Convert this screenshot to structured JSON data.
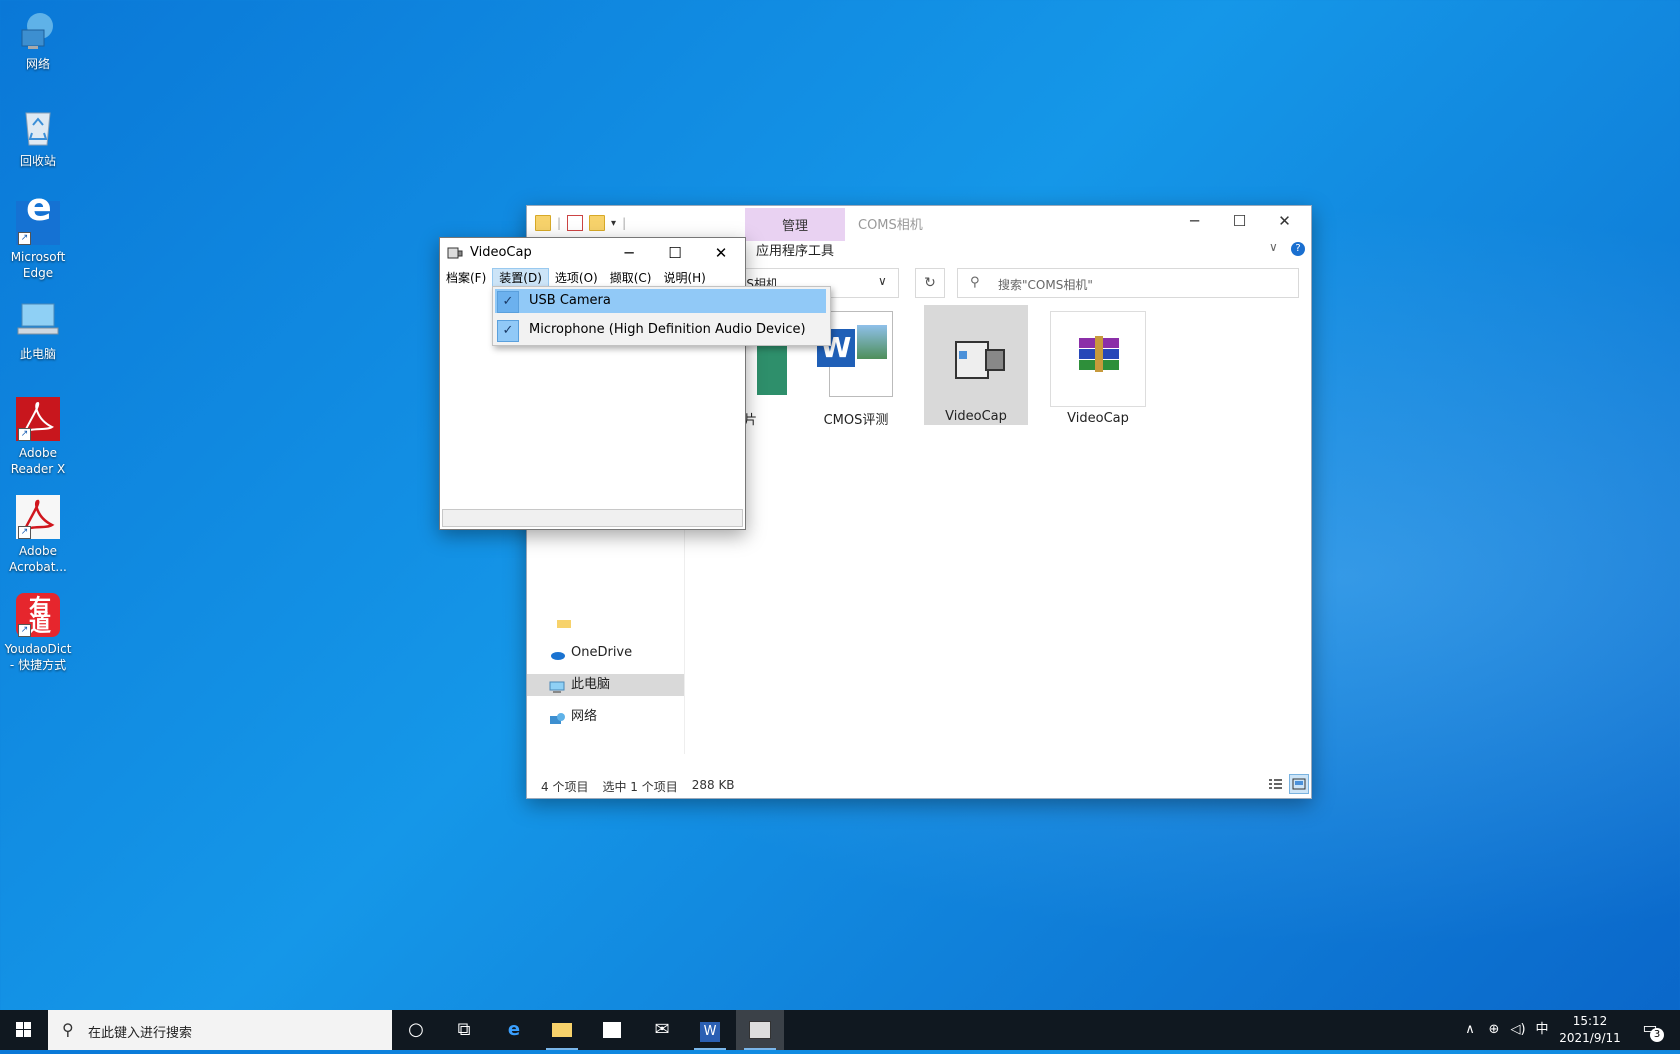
{
  "desktop": {
    "icons": [
      {
        "label": "网络",
        "icon": "network-icon"
      },
      {
        "label": "回收站",
        "icon": "recycle-bin-icon"
      },
      {
        "label": "Microsoft Edge",
        "icon": "edge-icon"
      },
      {
        "label": "此电脑",
        "icon": "this-pc-icon"
      },
      {
        "label": "Adobe Reader X",
        "icon": "adobe-reader-icon"
      },
      {
        "label": "Adobe Acrobat...",
        "icon": "adobe-acrobat-icon"
      },
      {
        "label": "YoudaoDict - 快捷方式",
        "icon": "youdao-icon"
      }
    ]
  },
  "explorer": {
    "title": "COMS相机",
    "ribbon_manage": "管理",
    "ribbon_apptools": "应用程序工具",
    "address": "MS相机",
    "search_placeholder": "搜索\"COMS相机\"",
    "nav": [
      {
        "label": "OneDrive",
        "icon": "onedrive-icon"
      },
      {
        "label": "此电脑",
        "icon": "this-pc-icon"
      },
      {
        "label": "网络",
        "icon": "network-icon"
      }
    ],
    "files": [
      {
        "label": "图片",
        "icon": "image-thumb-icon"
      },
      {
        "label": "CMOS评测",
        "icon": "word-doc-icon"
      },
      {
        "label": "VideoCap",
        "icon": "videocap-icon"
      },
      {
        "label": "VideoCap",
        "icon": "winrar-icon"
      }
    ],
    "status": {
      "count": "4 个项目",
      "selected": "选中 1 个项目",
      "size": "288 KB"
    }
  },
  "videocap": {
    "title": "VideoCap",
    "menu": [
      "档案(F)",
      "装置(D)",
      "选项(O)",
      "撷取(C)",
      "说明(H)"
    ],
    "dropdown": [
      "USB Camera",
      "Microphone (High Definition Audio Device)"
    ]
  },
  "taskbar": {
    "search_placeholder": "在此键入进行搜索",
    "ime": "中",
    "time": "15:12",
    "date": "2021/9/11",
    "notifications": "3"
  }
}
